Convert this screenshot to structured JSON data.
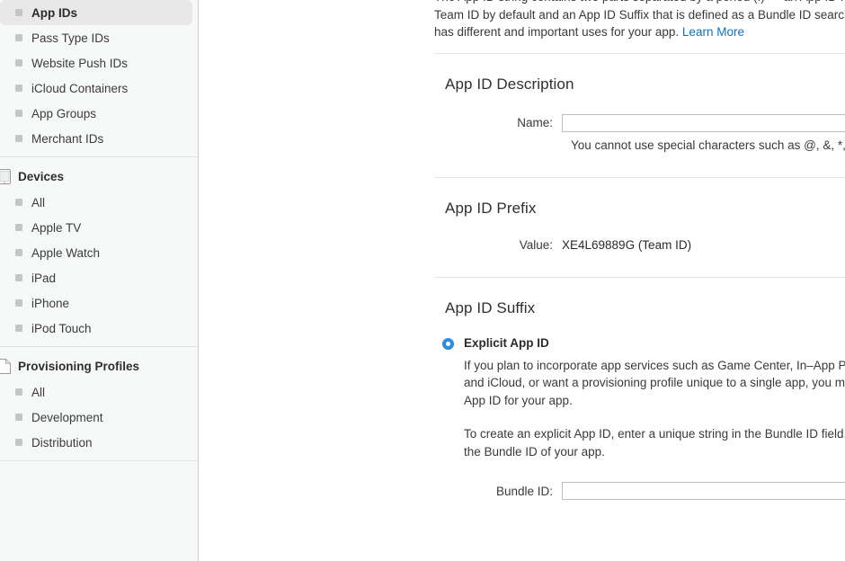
{
  "sidebar": {
    "groups": [
      {
        "name": "certificates-ids-profiles-top",
        "header": null,
        "header_icon": null,
        "items": [
          {
            "label": "App IDs",
            "selected": true
          },
          {
            "label": "Pass Type IDs",
            "selected": false
          },
          {
            "label": "Website Push IDs",
            "selected": false
          },
          {
            "label": "iCloud Containers",
            "selected": false
          },
          {
            "label": "App Groups",
            "selected": false
          },
          {
            "label": "Merchant IDs",
            "selected": false
          }
        ]
      },
      {
        "name": "devices",
        "header": "Devices",
        "header_icon": "device-icon",
        "items": [
          {
            "label": "All",
            "selected": false
          },
          {
            "label": "Apple TV",
            "selected": false
          },
          {
            "label": "Apple Watch",
            "selected": false
          },
          {
            "label": "iPad",
            "selected": false
          },
          {
            "label": "iPhone",
            "selected": false
          },
          {
            "label": "iPod Touch",
            "selected": false
          }
        ]
      },
      {
        "name": "provisioning-profiles",
        "header": "Provisioning Profiles",
        "header_icon": "document-icon",
        "items": [
          {
            "label": "All",
            "selected": false
          },
          {
            "label": "Development",
            "selected": false
          },
          {
            "label": "Distribution",
            "selected": false
          }
        ]
      }
    ]
  },
  "main": {
    "intro": {
      "text": "The App ID string contains two parts separated by a period (.) — an App ID Prefix that is defined as your Team ID by default and an App ID Suffix that is defined as a Bundle ID search string. Each part of an App ID has different and important uses for your app. ",
      "link_label": "Learn More"
    },
    "sections": [
      {
        "name": "app-id-description",
        "title": "App ID Description",
        "field_label": "Name:",
        "field_value": "",
        "field_placeholder": "",
        "hint": "You cannot use special characters such as @, &, *, ', \""
      },
      {
        "name": "app-id-prefix",
        "title": "App ID Prefix",
        "field_label": "Value:",
        "field_value": "XE4L69889G (Team ID)"
      },
      {
        "name": "app-id-suffix",
        "title": "App ID Suffix",
        "radio": {
          "selected": true,
          "title": "Explicit App ID",
          "paragraph_1": "If you plan to incorporate app services such as Game Center, In–App Purchase, Data Protection, and iCloud, or want a provisioning profile unique to a single app, you must register an explicit App ID for your app.",
          "paragraph_2": "To create an explicit App ID, enter a unique string in the Bundle ID field. This string should match the Bundle ID of your app.",
          "bundle_label": "Bundle ID:",
          "bundle_value": "",
          "bundle_placeholder": ""
        }
      }
    ]
  },
  "colors": {
    "link": "#0d72c7",
    "radio_selected": "#2e8fe0",
    "sidebar_bg": "#f7f9f8",
    "selection_bg": "#e8e8e8"
  }
}
